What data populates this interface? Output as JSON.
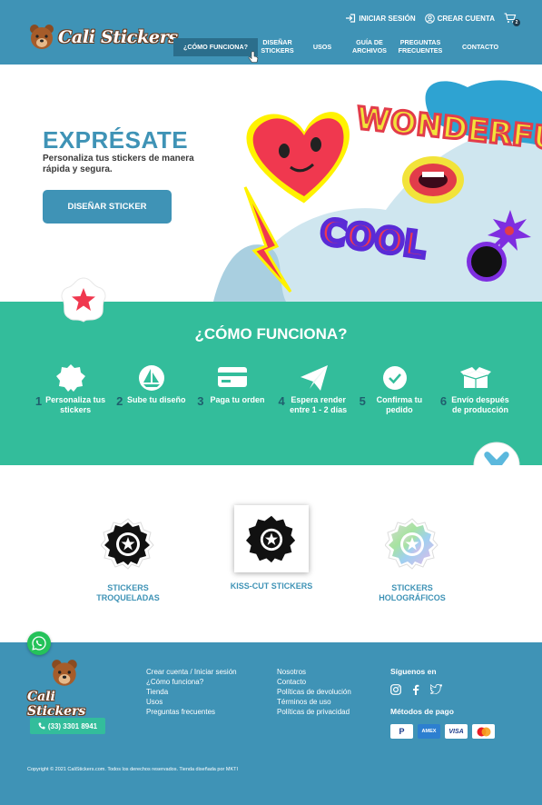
{
  "header": {
    "brand": "Cali Stickers",
    "login": "INICIAR SESIÓN",
    "register": "CREAR CUENTA",
    "cart_count": "2",
    "nav": [
      {
        "label": "¿CÓMO FUNCIONA?"
      },
      {
        "label": "DISEÑAR STICKERS"
      },
      {
        "label": "USOS"
      },
      {
        "label": "GUÍA DE ARCHIVOS"
      },
      {
        "label": "PREGUNTAS FRECUENTES"
      },
      {
        "label": "CONTACTO"
      }
    ]
  },
  "hero": {
    "title": "EXPRÉSATE",
    "subtitle": "Personaliza tus stickers de manera rápida y segura.",
    "button": "DISEÑAR STICKER",
    "art_words": [
      "WONDERFUL",
      "COOL"
    ]
  },
  "how": {
    "title": "¿CÓMO FUNCIONA?",
    "steps": [
      {
        "num": "1",
        "label": "Personaliza tus stickers",
        "icon": "badge-icon"
      },
      {
        "num": "2",
        "label": "Sube tu diseño",
        "icon": "upload-icon"
      },
      {
        "num": "3",
        "label": "Paga tu orden",
        "icon": "credit-card-icon"
      },
      {
        "num": "4",
        "label": "Espera render entre 1 - 2 días",
        "icon": "paper-plane-icon"
      },
      {
        "num": "5",
        "label": "Confirma tu pedido",
        "icon": "check-icon"
      },
      {
        "num": "6",
        "label": "Envío después de producción",
        "icon": "box-icon"
      }
    ]
  },
  "products": [
    {
      "label": "STICKERS TROQUELADAS"
    },
    {
      "label": "KISS-CUT STICKERS"
    },
    {
      "label": "STICKERS HOLOGRÁFICOS"
    }
  ],
  "footer": {
    "brand": "Cali Stickers",
    "phone": "(33) 3301 8941",
    "col1": [
      "Crear cuenta / Iniciar sesión",
      "¿Cómo funciona?",
      "Tienda",
      "Usos",
      "Preguntas frecuentes"
    ],
    "col2": [
      "Nosotros",
      "Contacto",
      "Políticas de devolución",
      "Términos de uso",
      "Políticas de privacidad"
    ],
    "social_heading": "Síguenos en",
    "payment_heading": "Métodos de pago",
    "payments": [
      "P",
      "AMEX",
      "VISA",
      "MC"
    ],
    "copyright": "Copyright © 2021 CaliStickers.com. Todos los derechos reservados. Tienda diseñada por MKTI"
  },
  "colors": {
    "brand_blue": "#3f93b6",
    "teal": "#33bd9b",
    "dark": "#1f3b4d"
  }
}
